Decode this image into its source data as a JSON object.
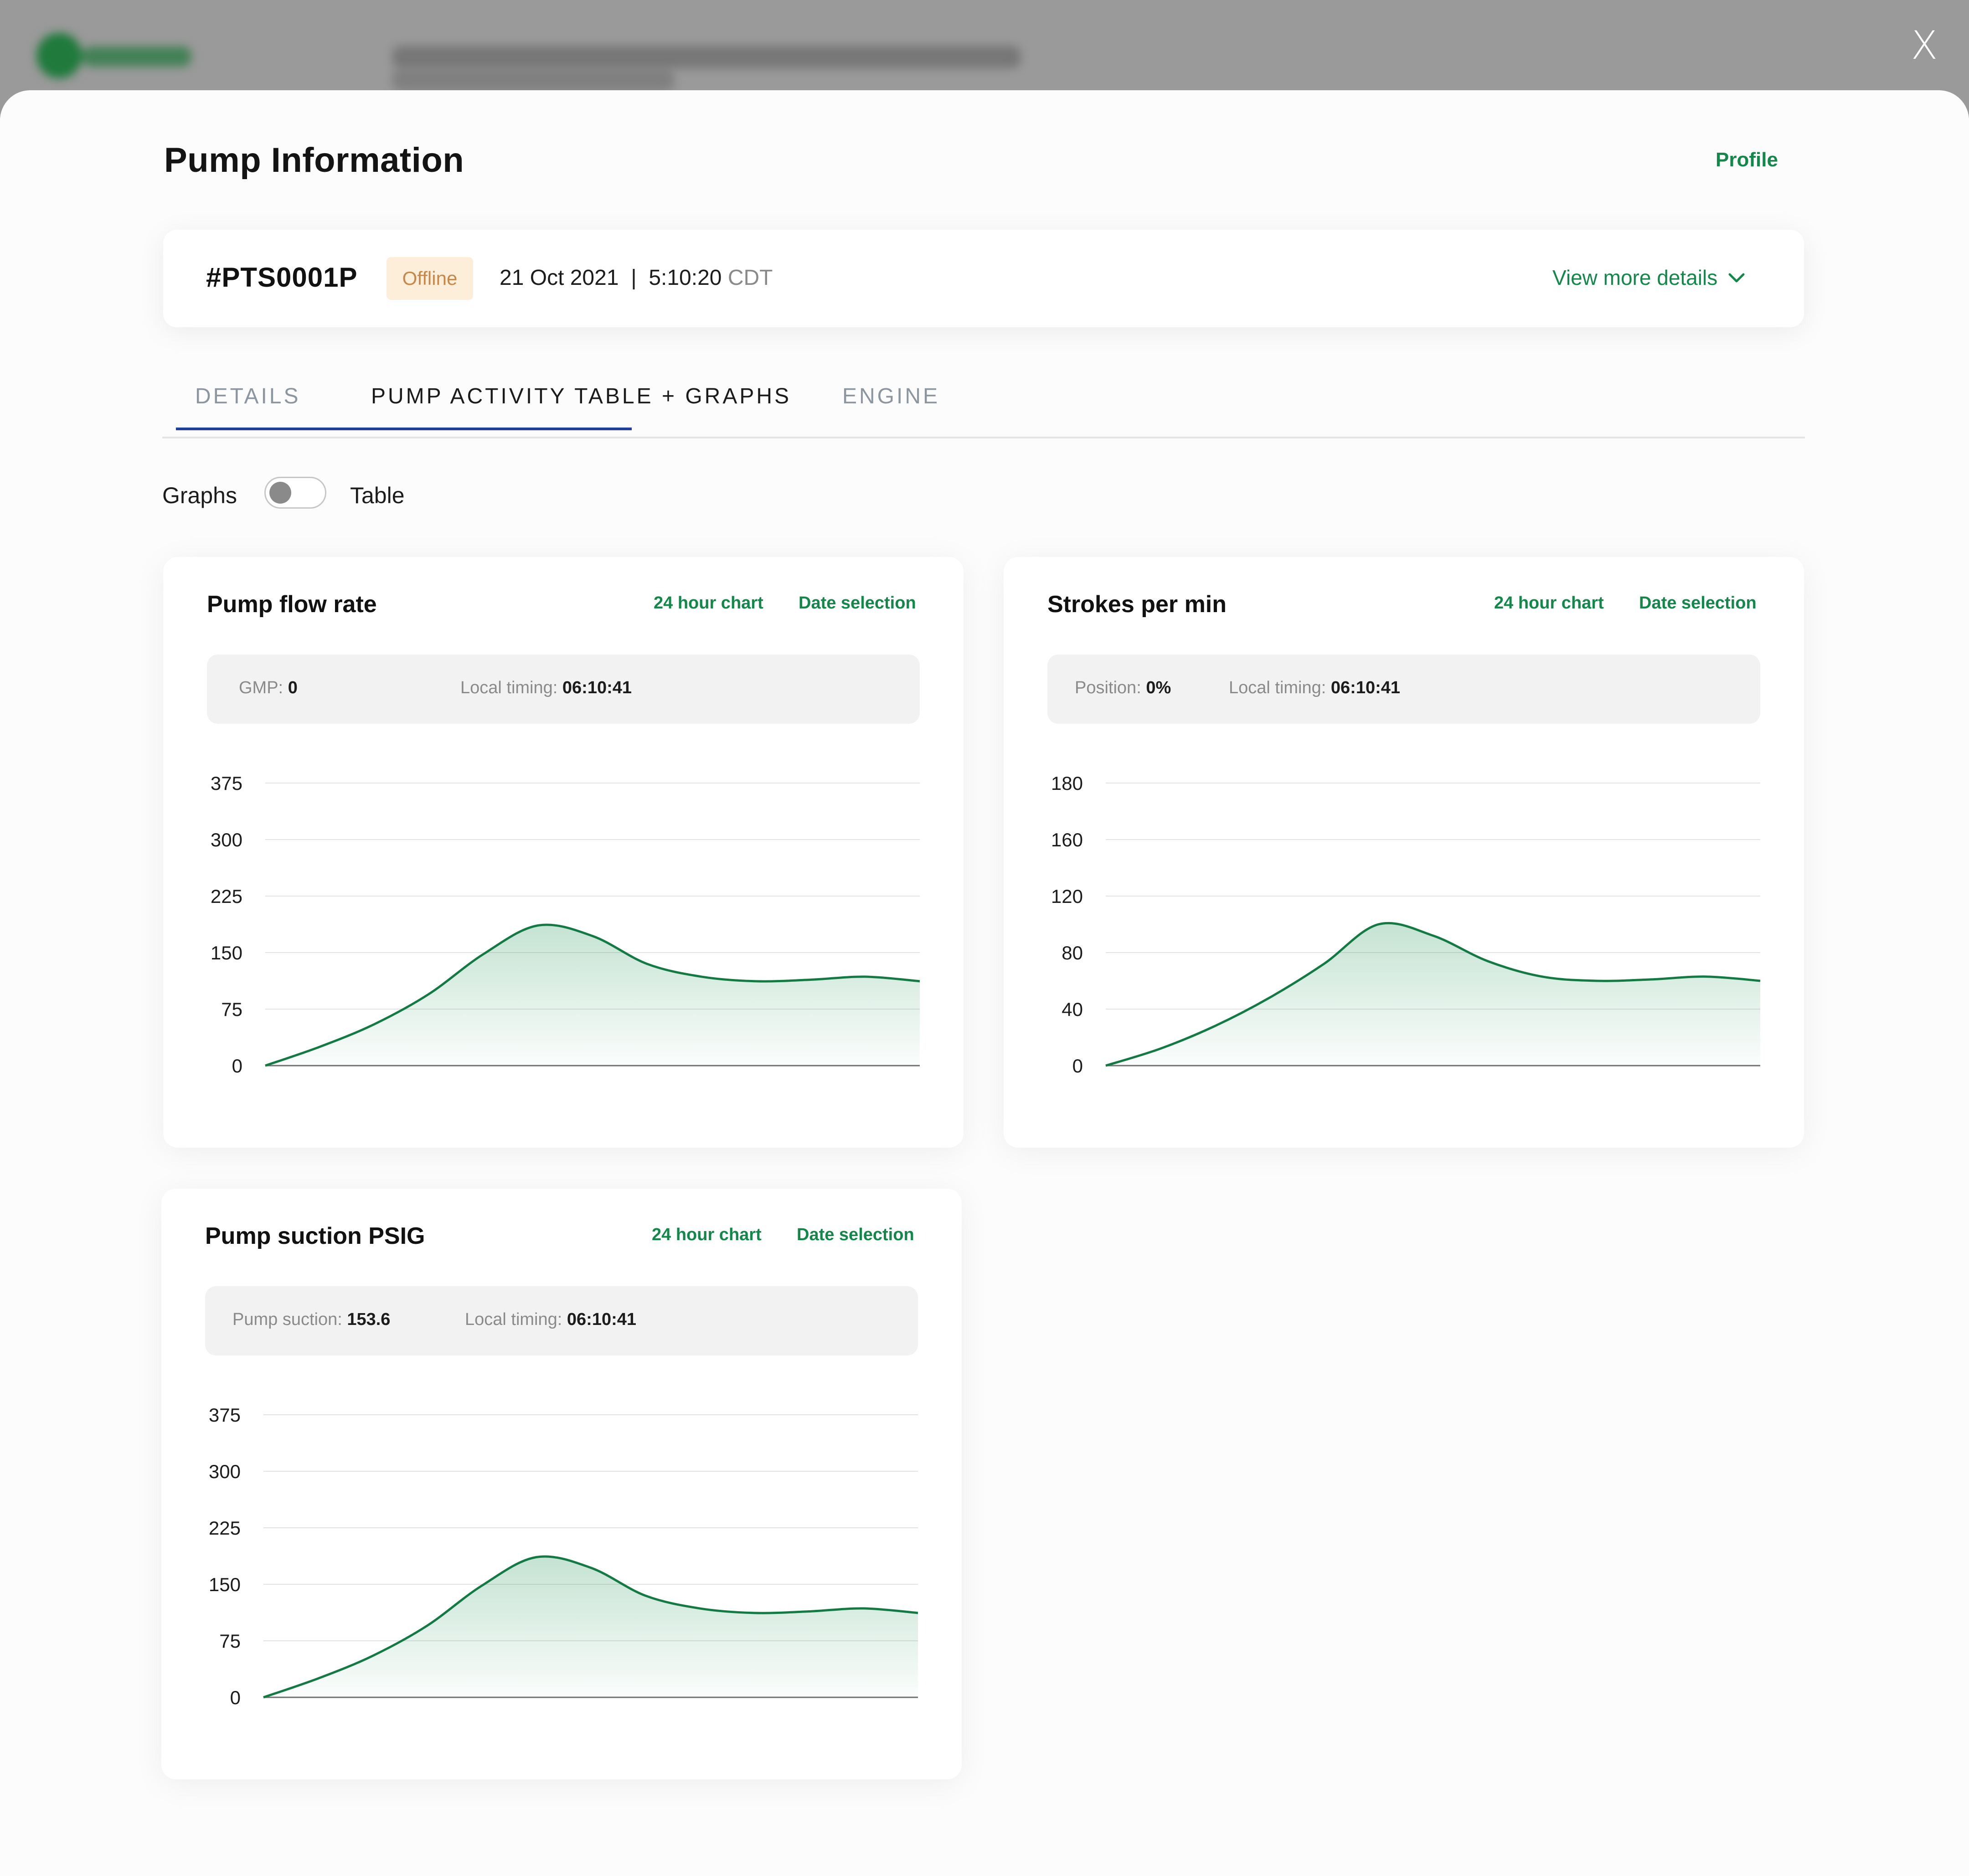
{
  "window": {
    "close_label": "X"
  },
  "header": {
    "title": "Pump Information",
    "profile_link": "Profile"
  },
  "pump": {
    "id": "#PTS0001P",
    "status": "Offline",
    "date": "21 Oct 2021",
    "separator": "|",
    "time": "5:10:20",
    "timezone": "CDT",
    "view_more": "View more details"
  },
  "tabs": [
    {
      "label": "DETAILS",
      "active": false
    },
    {
      "label": "PUMP ACTIVITY TABLE + GRAPHS",
      "active": true
    },
    {
      "label": "ENGINE",
      "active": false
    }
  ],
  "view_toggle": {
    "left_label": "Graphs",
    "right_label": "Table",
    "state": "Graphs"
  },
  "colors": {
    "accent": "#14874a",
    "line": "#137a43",
    "tab_underline": "#1f3f9e",
    "badge_bg": "#fdeed9",
    "badge_text": "#c8874a"
  },
  "charts": [
    {
      "title": "Pump flow rate",
      "link_24h": "24 hour chart",
      "link_date": "Date selection",
      "readout": [
        {
          "label": "GMP: ",
          "value": "0"
        },
        {
          "label": "Local timing: ",
          "value": "06:10:41"
        }
      ]
    },
    {
      "title": "Strokes per min",
      "link_24h": "24 hour chart",
      "link_date": "Date selection",
      "readout": [
        {
          "label": "Position: ",
          "value": "0%"
        },
        {
          "label": "Local timing: ",
          "value": "06:10:41"
        }
      ]
    },
    {
      "title": "Pump suction PSIG",
      "link_24h": "24 hour chart",
      "link_date": "Date selection",
      "readout": [
        {
          "label": "Pump suction: ",
          "value": "153.6"
        },
        {
          "label": "Local timing: ",
          "value": "06:10:41"
        }
      ]
    }
  ],
  "chart_data": [
    {
      "type": "area",
      "title": "Pump flow rate",
      "xlabel": "",
      "ylabel": "",
      "y_ticks": [
        "0",
        "75",
        "150",
        "225",
        "300",
        "375"
      ],
      "x": [
        0,
        1,
        2,
        3,
        4,
        5,
        6,
        7,
        8,
        9,
        10,
        11,
        12
      ],
      "values": [
        0,
        25,
        55,
        95,
        148,
        186,
        172,
        135,
        118,
        112,
        114,
        118,
        112
      ],
      "grid": true
    },
    {
      "type": "area",
      "title": "Strokes per min",
      "xlabel": "",
      "ylabel": "",
      "y_ticks": [
        "0",
        "40",
        "80",
        "120",
        "160",
        "180"
      ],
      "x": [
        0,
        1,
        2,
        3,
        4,
        5,
        6,
        7,
        8,
        9,
        10,
        11,
        12
      ],
      "values": [
        0,
        12,
        28,
        48,
        72,
        100,
        92,
        74,
        63,
        60,
        61,
        63,
        60
      ],
      "grid": true
    },
    {
      "type": "area",
      "title": "Pump suction PSIG",
      "xlabel": "",
      "ylabel": "",
      "y_ticks": [
        "0",
        "75",
        "150",
        "225",
        "300",
        "375"
      ],
      "x": [
        0,
        1,
        2,
        3,
        4,
        5,
        6,
        7,
        8,
        9,
        10,
        11,
        12
      ],
      "values": [
        0,
        25,
        55,
        95,
        148,
        186,
        172,
        135,
        118,
        112,
        114,
        118,
        112
      ],
      "grid": true
    }
  ]
}
